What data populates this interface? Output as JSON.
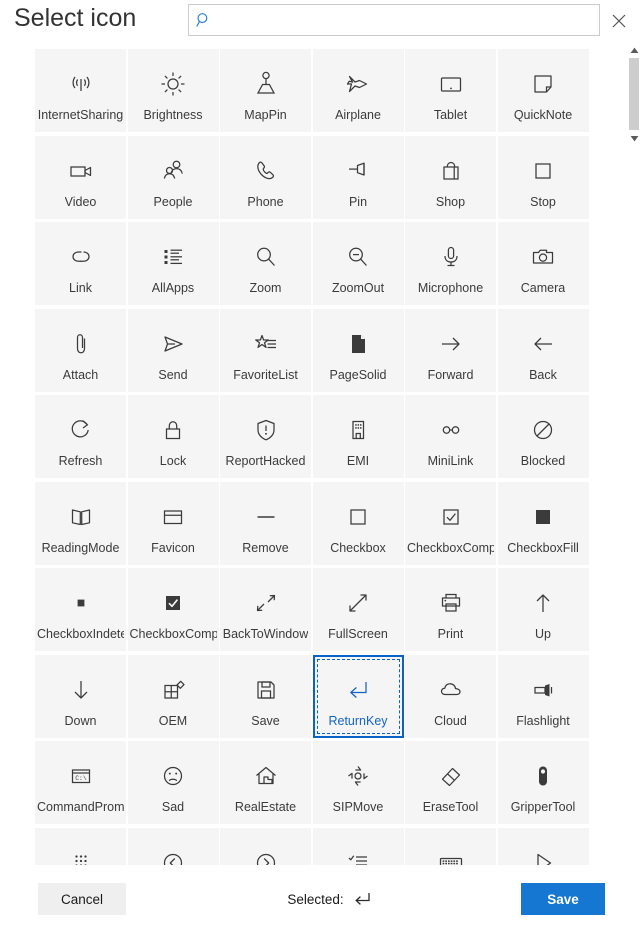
{
  "header": {
    "title": "Select icon",
    "search": {
      "value": "",
      "placeholder": ""
    },
    "search_icon": "search-icon",
    "close_icon": "close-icon"
  },
  "grid": {
    "selected_icon": "ReturnKey",
    "items": [
      {
        "label": "InternetSharing",
        "icon": "internet-sharing-icon"
      },
      {
        "label": "Brightness",
        "icon": "brightness-icon"
      },
      {
        "label": "MapPin",
        "icon": "map-pin-icon"
      },
      {
        "label": "Airplane",
        "icon": "airplane-icon"
      },
      {
        "label": "Tablet",
        "icon": "tablet-icon"
      },
      {
        "label": "QuickNote",
        "icon": "quick-note-icon"
      },
      {
        "label": "Video",
        "icon": "video-icon"
      },
      {
        "label": "People",
        "icon": "people-icon"
      },
      {
        "label": "Phone",
        "icon": "phone-icon"
      },
      {
        "label": "Pin",
        "icon": "pin-icon"
      },
      {
        "label": "Shop",
        "icon": "shop-icon"
      },
      {
        "label": "Stop",
        "icon": "stop-icon"
      },
      {
        "label": "Link",
        "icon": "link-icon"
      },
      {
        "label": "AllApps",
        "icon": "all-apps-icon"
      },
      {
        "label": "Zoom",
        "icon": "zoom-icon"
      },
      {
        "label": "ZoomOut",
        "icon": "zoom-out-icon"
      },
      {
        "label": "Microphone",
        "icon": "microphone-icon"
      },
      {
        "label": "Camera",
        "icon": "camera-icon"
      },
      {
        "label": "Attach",
        "icon": "attach-icon"
      },
      {
        "label": "Send",
        "icon": "send-icon"
      },
      {
        "label": "FavoriteList",
        "icon": "favorite-list-icon"
      },
      {
        "label": "PageSolid",
        "icon": "page-solid-icon"
      },
      {
        "label": "Forward",
        "icon": "forward-icon"
      },
      {
        "label": "Back",
        "icon": "back-icon"
      },
      {
        "label": "Refresh",
        "icon": "refresh-icon"
      },
      {
        "label": "Lock",
        "icon": "lock-icon"
      },
      {
        "label": "ReportHacked",
        "icon": "report-hacked-icon"
      },
      {
        "label": "EMI",
        "icon": "emi-icon"
      },
      {
        "label": "MiniLink",
        "icon": "mini-link-icon"
      },
      {
        "label": "Blocked",
        "icon": "blocked-icon"
      },
      {
        "label": "ReadingMode",
        "icon": "reading-mode-icon"
      },
      {
        "label": "Favicon",
        "icon": "favicon-icon"
      },
      {
        "label": "Remove",
        "icon": "remove-icon"
      },
      {
        "label": "Checkbox",
        "icon": "checkbox-icon"
      },
      {
        "label": "CheckboxComp",
        "icon": "checkbox-composite-icon"
      },
      {
        "label": "CheckboxFill",
        "icon": "checkbox-fill-icon"
      },
      {
        "label": "CheckboxIndete",
        "icon": "checkbox-indeterminate-icon"
      },
      {
        "label": "CheckboxComp",
        "icon": "checkbox-composite-filled-icon"
      },
      {
        "label": "BackToWindow",
        "icon": "back-to-window-icon"
      },
      {
        "label": "FullScreen",
        "icon": "full-screen-icon"
      },
      {
        "label": "Print",
        "icon": "print-icon"
      },
      {
        "label": "Up",
        "icon": "up-icon"
      },
      {
        "label": "Down",
        "icon": "down-icon"
      },
      {
        "label": "OEM",
        "icon": "oem-icon"
      },
      {
        "label": "Save",
        "icon": "save-icon"
      },
      {
        "label": "ReturnKey",
        "icon": "return-key-icon"
      },
      {
        "label": "Cloud",
        "icon": "cloud-icon"
      },
      {
        "label": "Flashlight",
        "icon": "flashlight-icon"
      },
      {
        "label": "CommandProm",
        "icon": "command-prompt-icon"
      },
      {
        "label": "Sad",
        "icon": "sad-icon"
      },
      {
        "label": "RealEstate",
        "icon": "real-estate-icon"
      },
      {
        "label": "SIPMove",
        "icon": "sip-move-icon"
      },
      {
        "label": "EraseTool",
        "icon": "erase-tool-icon"
      },
      {
        "label": "GripperTool",
        "icon": "gripper-tool-icon"
      },
      {
        "label": "",
        "icon": "keypad-icon"
      },
      {
        "label": "",
        "icon": "chevron-left-circle-icon"
      },
      {
        "label": "",
        "icon": "chevron-right-circle-icon"
      },
      {
        "label": "",
        "icon": "check-list-icon"
      },
      {
        "label": "",
        "icon": "keyboard-icon"
      },
      {
        "label": "",
        "icon": "play-icon"
      }
    ]
  },
  "scrollbar": {
    "up_arrow_icon": "scroll-up-arrow-icon",
    "down_arrow_icon": "scroll-down-arrow-icon"
  },
  "footer": {
    "cancel_label": "Cancel",
    "selected_label": "Selected:",
    "selected_glyph_icon": "return-key-icon",
    "save_label": "Save"
  },
  "colors": {
    "accent": "#1577d2",
    "selection_border": "#0a64c8",
    "selection_text": "#1464c8",
    "tile_bg": "#f5f5f5",
    "icon": "#3b3b3b"
  }
}
